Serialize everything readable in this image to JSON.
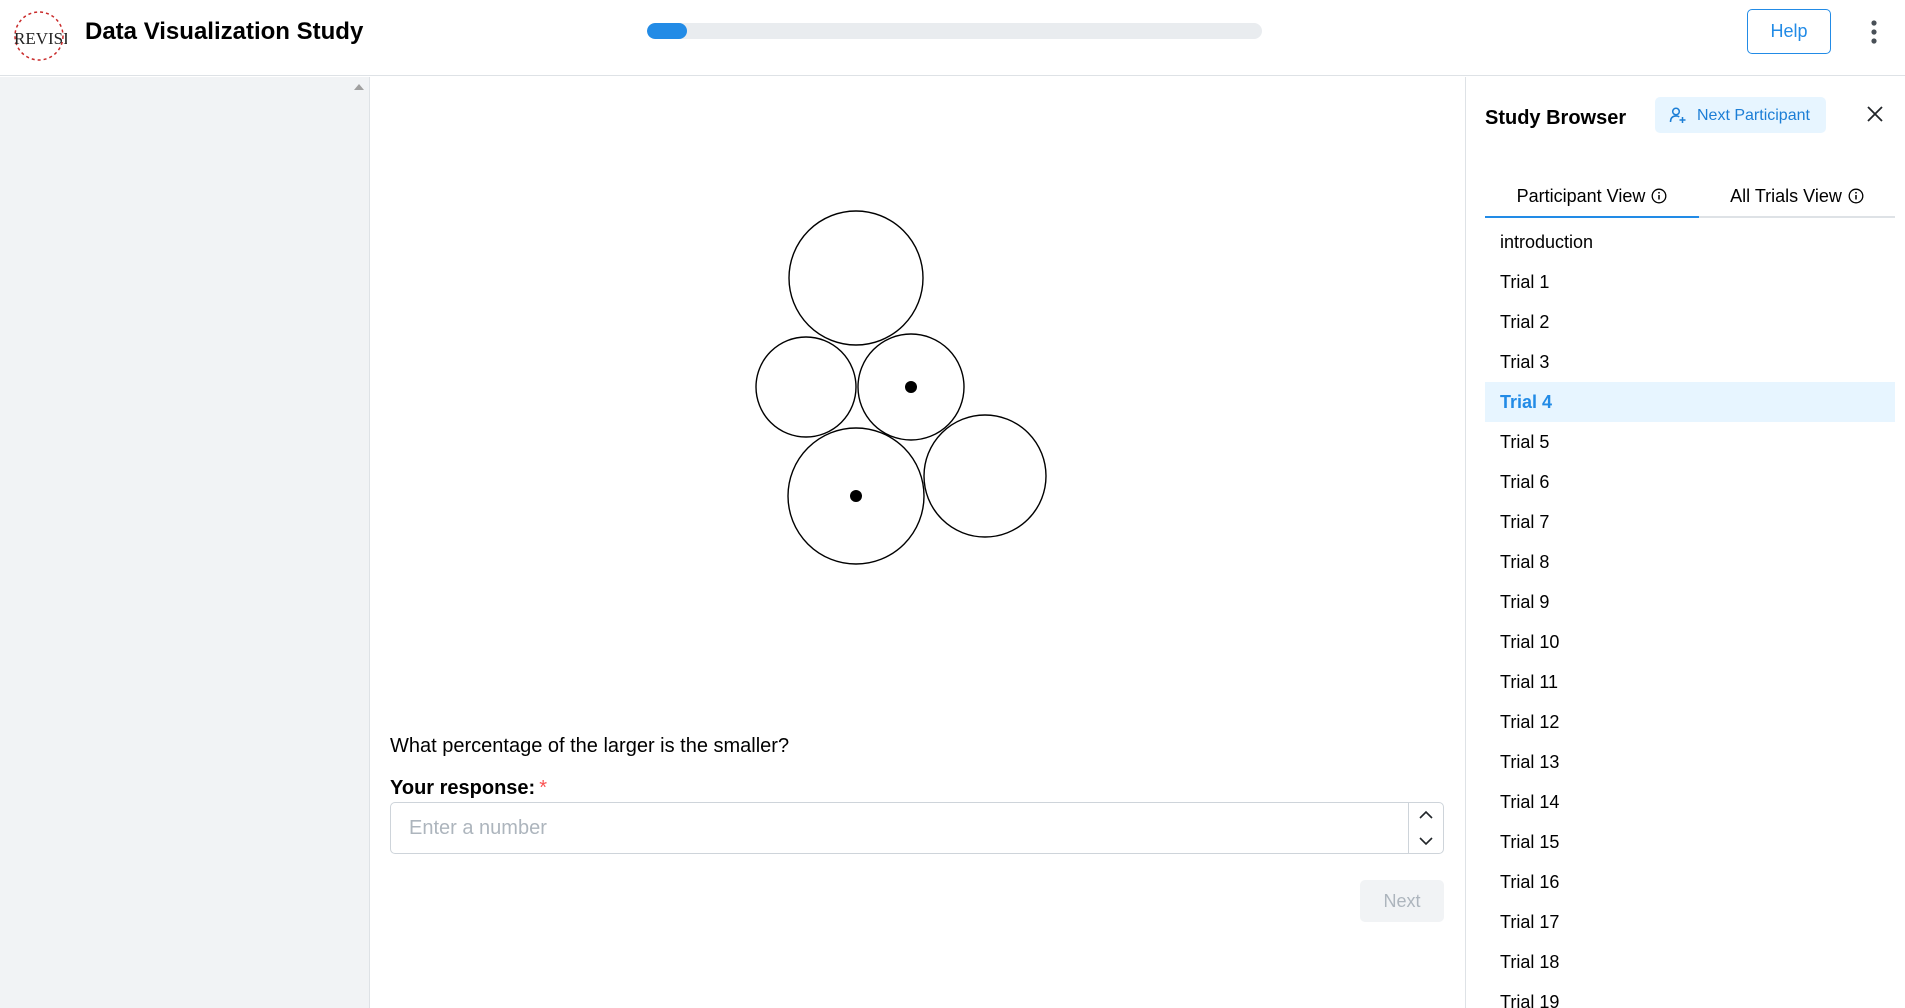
{
  "header": {
    "title": "Data Visualization Study",
    "logo_icon": "revisit-logo-icon",
    "progress": 0.065,
    "help_label": "Help",
    "menu_icon": "vertical-dots-icon",
    "accent_color": "#228be6"
  },
  "stimulus": {
    "description_icon": "circle-comparison-stimulus",
    "circle_count": 5,
    "marked_circle_count": 2
  },
  "question": {
    "text": "What percentage of the larger is the smaller?",
    "response_label": "Your response:",
    "required_marker": "*",
    "input_placeholder": "Enter a number",
    "input_value": "",
    "next_label": "Next"
  },
  "study_browser": {
    "title": "Study Browser",
    "next_participant_label": "Next Participant",
    "tabs": [
      {
        "label": "Participant View",
        "active": true
      },
      {
        "label": "All Trials View",
        "active": false
      }
    ],
    "items": [
      {
        "label": "introduction"
      },
      {
        "label": "Trial 1"
      },
      {
        "label": "Trial 2"
      },
      {
        "label": "Trial 3"
      },
      {
        "label": "Trial 4",
        "active": true
      },
      {
        "label": "Trial 5"
      },
      {
        "label": "Trial 6"
      },
      {
        "label": "Trial 7"
      },
      {
        "label": "Trial 8"
      },
      {
        "label": "Trial 9"
      },
      {
        "label": "Trial 10"
      },
      {
        "label": "Trial 11"
      },
      {
        "label": "Trial 12"
      },
      {
        "label": "Trial 13"
      },
      {
        "label": "Trial 14"
      },
      {
        "label": "Trial 15"
      },
      {
        "label": "Trial 16"
      },
      {
        "label": "Trial 17"
      },
      {
        "label": "Trial 18"
      },
      {
        "label": "Trial 19"
      }
    ]
  }
}
